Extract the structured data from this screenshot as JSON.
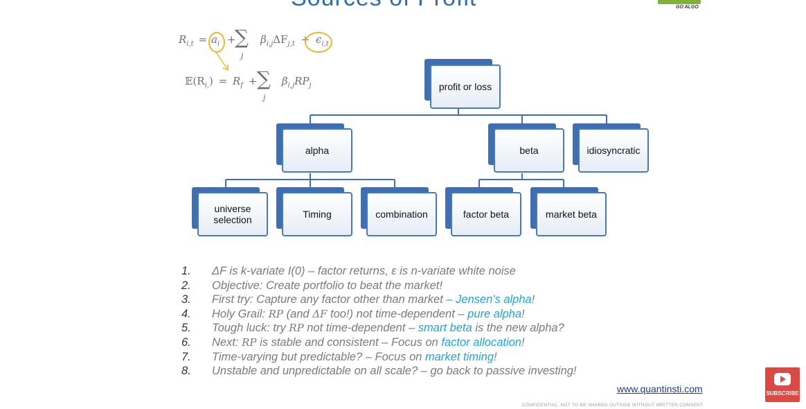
{
  "slide": {
    "title_partial": "Sources of Profit",
    "logo_text": "GO ALGO"
  },
  "formulas": {
    "line1": {
      "lhs": "R",
      "lhs_sub": "i,t",
      "eq": "=",
      "alpha": "a",
      "alpha_sub": "i",
      "plus1": "+",
      "sum": "∑",
      "sum_sub": "j",
      "beta_term": "β",
      "beta_sub": "i,j",
      "delta": "ΔF",
      "delta_sub": "j,t",
      "plus2": "+",
      "eps": "ϵ",
      "eps_sub": "i,t"
    },
    "line2": {
      "lhs": "𝔼(R",
      "lhs_sub": "i,",
      "close": ")",
      "eq": "=",
      "rf": "R",
      "rf_sub": "f",
      "plus": "+",
      "sum": "∑",
      "sum_sub": "j",
      "beta_term": "β",
      "beta_sub": "i,j",
      "rp": "RP",
      "rp_sub": "j"
    }
  },
  "tree": {
    "root": "profit or loss",
    "level1": [
      "alpha",
      "beta",
      "idiosyncratic"
    ],
    "alpha_children": [
      "universe selection",
      "Timing",
      "combination"
    ],
    "beta_children": [
      "factor beta",
      "market beta"
    ]
  },
  "notes": [
    {
      "num": "1.",
      "parts": [
        {
          "t": "ΔF is k-variate I(0) – factor returns, ε is n-variate white noise",
          "hl": false
        }
      ]
    },
    {
      "num": "2.",
      "parts": [
        {
          "t": "Objective: Create portfolio to beat the market!",
          "hl": false
        }
      ]
    },
    {
      "num": "3.",
      "parts": [
        {
          "t": "First try: Capture any factor other than market ",
          "hl": false
        },
        {
          "t": "– Jensen's alpha",
          "hl": true
        },
        {
          "t": "!",
          "hl": false
        }
      ]
    },
    {
      "num": "4.",
      "parts": [
        {
          "t": "Holy Grail: ",
          "hl": false
        },
        {
          "t": "RP",
          "hl": false,
          "math": true
        },
        {
          "t": " (and ",
          "hl": false
        },
        {
          "t": "ΔF",
          "hl": false,
          "math": true
        },
        {
          "t": " too!) not time-dependent – ",
          "hl": false
        },
        {
          "t": "pure alpha",
          "hl": true
        },
        {
          "t": "!",
          "hl": false
        }
      ]
    },
    {
      "num": "5.",
      "parts": [
        {
          "t": "Tough luck: try ",
          "hl": false
        },
        {
          "t": "RP",
          "hl": false,
          "math": true
        },
        {
          "t": " not time-dependent – ",
          "hl": false
        },
        {
          "t": "smart beta",
          "hl": true
        },
        {
          "t": " is the new alpha?",
          "hl": false
        }
      ]
    },
    {
      "num": "6.",
      "parts": [
        {
          "t": "Next: ",
          "hl": false
        },
        {
          "t": "RP",
          "hl": false,
          "math": true
        },
        {
          "t": " is stable and consistent – Focus on ",
          "hl": false
        },
        {
          "t": "factor allocation",
          "hl": true
        },
        {
          "t": "!",
          "hl": false
        }
      ]
    },
    {
      "num": "7.",
      "parts": [
        {
          "t": "Time-varying but predictable? – Focus on ",
          "hl": false
        },
        {
          "t": "market timing",
          "hl": true
        },
        {
          "t": "!",
          "hl": false
        }
      ]
    },
    {
      "num": "8.",
      "parts": [
        {
          "t": "Unstable and unpredictable on all scale? – go back to passive investing!",
          "hl": false
        }
      ]
    }
  ],
  "footer": {
    "website": "www.quantinsti.com",
    "confidential": "CONFIDENTIAL. NOT TO BE SHARED OUTSIDE WITHOUT WRITTEN CONSENT."
  },
  "subscribe": {
    "label": "SUBSCRIBE",
    "icon": "youtube-play-icon"
  },
  "colors": {
    "accent_blue": "#3f6fb0",
    "highlight": "#1fa3d8",
    "circle": "#e8b832",
    "subscribe_red": "#d84a44"
  }
}
